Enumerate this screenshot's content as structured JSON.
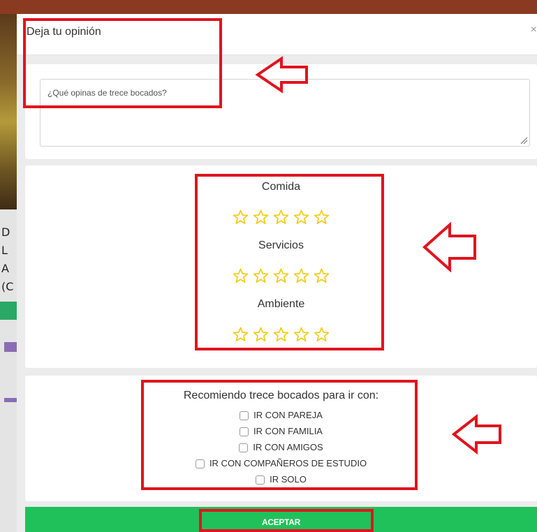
{
  "colors": {
    "accent_green": "#20c15a",
    "annotation_red": "#e0141e",
    "star_yellow": "#f3cc13",
    "topbar_brown": "#8b3a22"
  },
  "background_page": {
    "side_letters": [
      "D",
      "L",
      "A",
      "(C"
    ]
  },
  "modal": {
    "title": "Deja tu opinión",
    "close_icon": "close-icon",
    "comment": {
      "placeholder": "¿Qué opinas de trece bocados?",
      "value": ""
    },
    "ratings": [
      {
        "label": "Comida",
        "stars_total": 5,
        "stars_filled": 0
      },
      {
        "label": "Servicios",
        "stars_total": 5,
        "stars_filled": 0
      },
      {
        "label": "Ambiente",
        "stars_total": 5,
        "stars_filled": 0
      }
    ],
    "star_icon": "star-outline-icon",
    "recommend": {
      "title": "Recomiendo trece bocados para ir con:",
      "options": [
        {
          "label": "IR CON PAREJA",
          "checked": false
        },
        {
          "label": "IR CON FAMILIA",
          "checked": false
        },
        {
          "label": "IR CON AMIGOS",
          "checked": false
        },
        {
          "label": "IR CON COMPAÑEROS DE ESTUDIO",
          "checked": false
        },
        {
          "label": "IR SOLO",
          "checked": false
        }
      ]
    },
    "accept_label": "ACEPTAR"
  },
  "annotations": {
    "highlight_boxes": 4,
    "arrow_icon": "left-arrow-outline-icon"
  }
}
